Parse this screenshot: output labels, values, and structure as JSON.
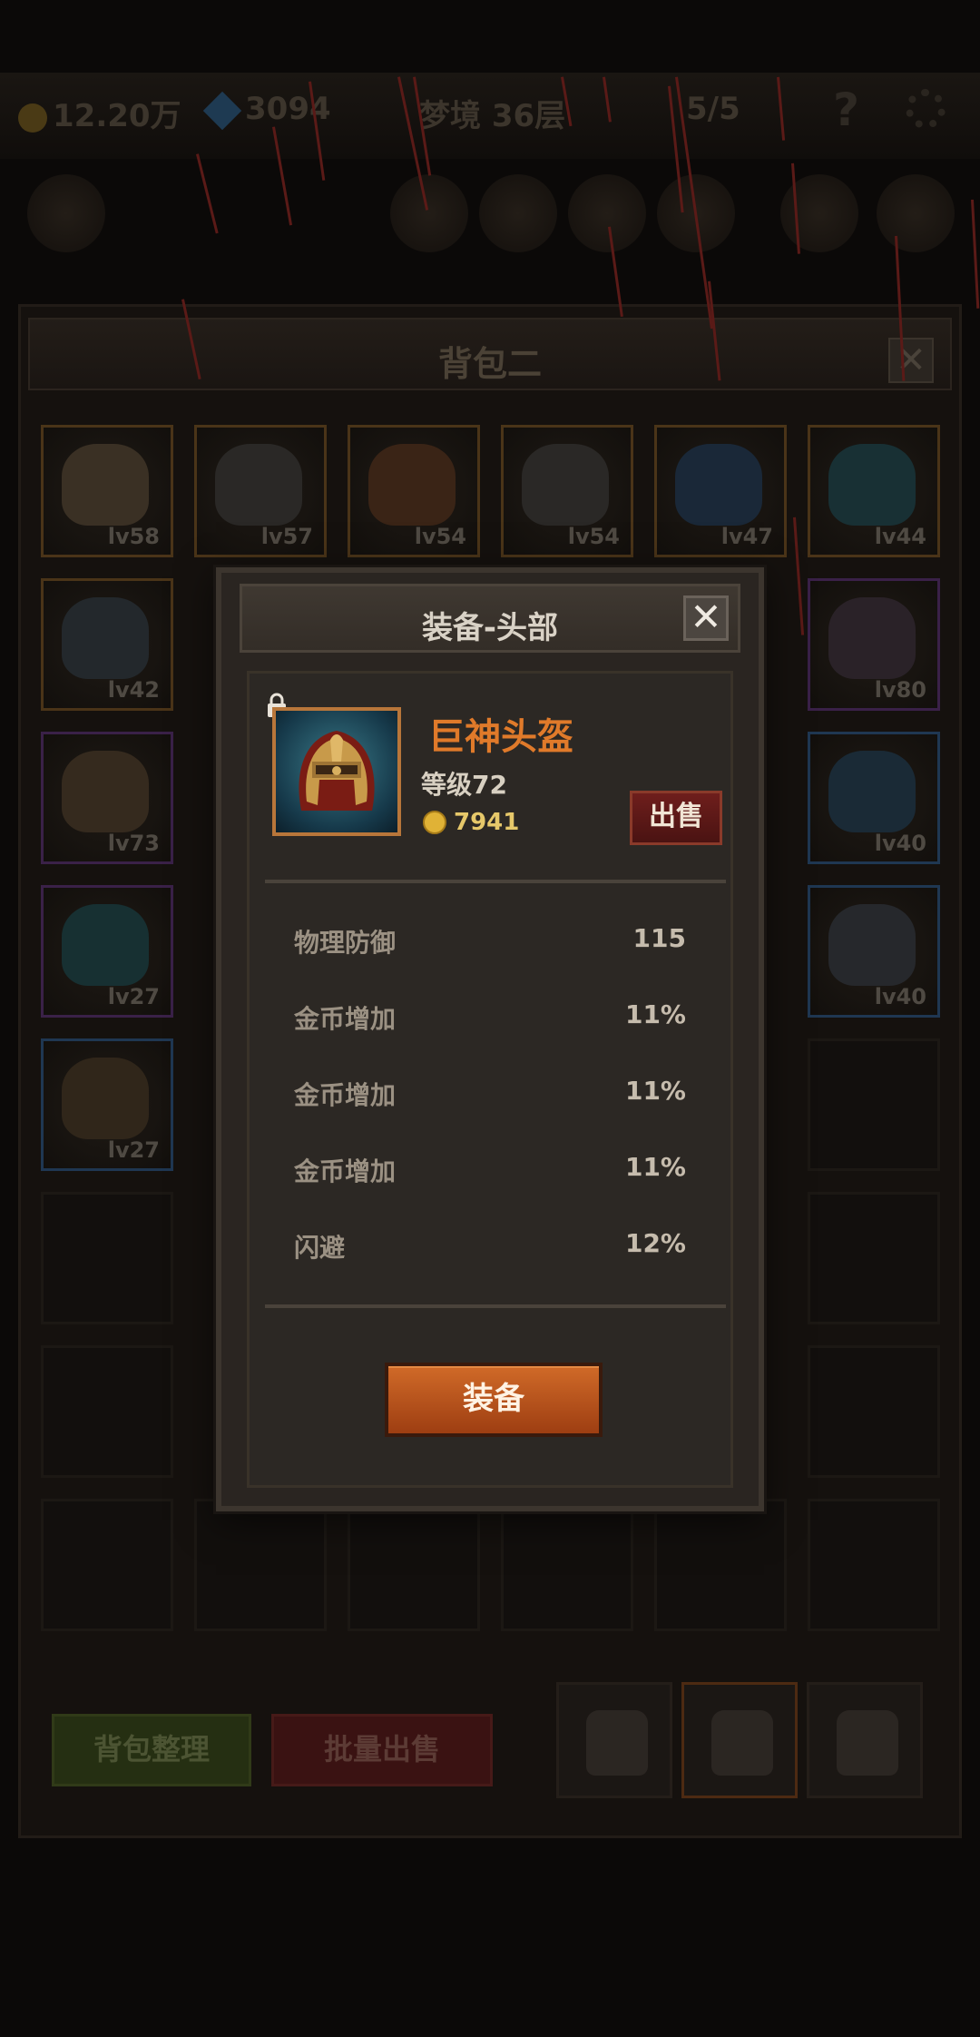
{
  "hud": {
    "coins": "12.20万",
    "gems": "3094",
    "dream": "梦境 36层",
    "energy": "5/5",
    "help": "?"
  },
  "bag": {
    "title": "背包二",
    "close": "✕",
    "items": [
      {
        "level": "lv58",
        "quality": "orange",
        "color": "#3a3024"
      },
      {
        "level": "lv57",
        "quality": "orange",
        "color": "#2a2826"
      },
      {
        "level": "lv54",
        "quality": "orange",
        "color": "#3a2416"
      },
      {
        "level": "lv54",
        "quality": "orange",
        "color": "#2a2826"
      },
      {
        "level": "lv47",
        "quality": "orange",
        "color": "#1a2838"
      },
      {
        "level": "lv44",
        "quality": "orange",
        "color": "#183034"
      },
      {
        "level": "lv42",
        "quality": "orange",
        "color": "#23282c"
      },
      {
        "level": "lv80",
        "quality": "purple",
        "color": "#2a2228"
      },
      {
        "level": "lv73",
        "quality": "purple",
        "color": "#352a1e"
      },
      {
        "level": "lv40",
        "quality": "purple",
        "color": "#1a2a36"
      },
      {
        "level": "lv27",
        "quality": "purple",
        "color": "#173032"
      },
      {
        "level": "lv40",
        "quality": "blue",
        "color": "#26282c"
      },
      {
        "level": "lv27",
        "quality": "blue",
        "color": "#30261a"
      }
    ],
    "sort_button": "背包整理",
    "batch_sell_button": "批量出售"
  },
  "dialog": {
    "title": "装备-头部",
    "close": "✕",
    "item_name": "巨神头盔",
    "item_level": "等级72",
    "price": "7941",
    "sell_button": "出售",
    "stats": [
      {
        "name": "物理防御",
        "value": "115"
      },
      {
        "name": "金币增加",
        "value": "11%"
      },
      {
        "name": "金币增加",
        "value": "11%"
      },
      {
        "name": "金币增加",
        "value": "11%"
      },
      {
        "name": "闪避",
        "value": "12%"
      }
    ],
    "equip_button": "装备"
  },
  "colors": {
    "item_name": "#e07a2a",
    "equip_button": "#c25a20",
    "sell_button": "#5e1a18",
    "gold": "#e0b236"
  }
}
